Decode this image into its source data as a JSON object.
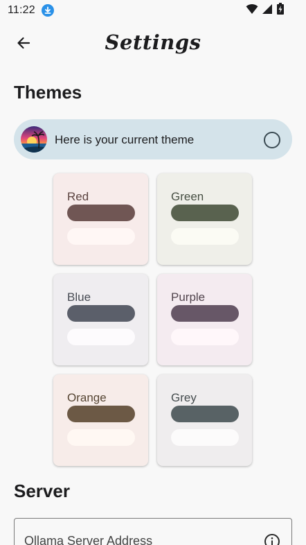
{
  "status_bar": {
    "time": "11:22",
    "icons": [
      "download-icon",
      "wifi-icon",
      "signal-icon",
      "battery-charging-icon"
    ]
  },
  "app_bar": {
    "back_icon": "arrow-left-icon",
    "title": "Settings"
  },
  "themes_section": {
    "heading": "Themes",
    "current_theme": {
      "label": "Here is your current theme",
      "avatar_icon": "sunset-palm-avatar",
      "radio_icon": "radio-unchecked-icon",
      "background": "#d4e3ea"
    },
    "options": [
      {
        "name": "Red",
        "card_bg": "#f7ebea",
        "text_color": "#5b4340",
        "primary": "#705654",
        "secondary": "#fff7f5"
      },
      {
        "name": "Green",
        "card_bg": "#efefe9",
        "text_color": "#474f43",
        "primary": "#59624f",
        "secondary": "#fbfbf4"
      },
      {
        "name": "Blue",
        "card_bg": "#efedf0",
        "text_color": "#464a52",
        "primary": "#5b5f6a",
        "secondary": "#fdfbfd"
      },
      {
        "name": "Purple",
        "card_bg": "#f4ebf0",
        "text_color": "#51444d",
        "primary": "#675767",
        "secondary": "#fff7fa"
      },
      {
        "name": "Orange",
        "card_bg": "#f7ece9",
        "text_color": "#574634",
        "primary": "#6c5945",
        "secondary": "#fff8f3"
      },
      {
        "name": "Grey",
        "card_bg": "#efedee",
        "text_color": "#454c4e",
        "primary": "#586265",
        "secondary": "#fcfbfb"
      }
    ]
  },
  "server_section": {
    "heading": "Server",
    "address_field": {
      "label": "Ollama Server Address",
      "value": "",
      "trailing_icon": "info-icon"
    }
  }
}
